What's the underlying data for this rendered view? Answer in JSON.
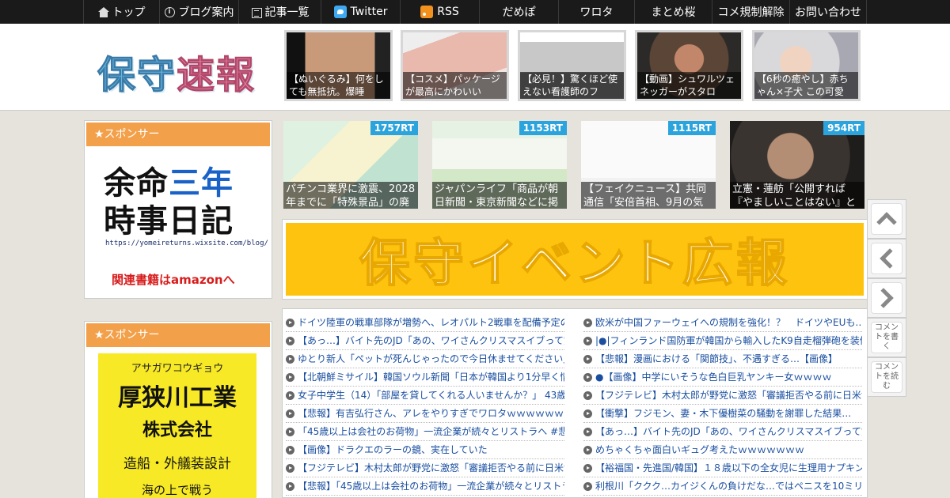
{
  "nav": [
    {
      "label": "トップ",
      "icon": "home-icon"
    },
    {
      "label": "ブログ案内",
      "icon": "info-icon"
    },
    {
      "label": "記事一覧",
      "icon": "list-icon"
    },
    {
      "label": "Twitter",
      "icon": "twitter-icon"
    },
    {
      "label": "RSS",
      "icon": "rss-icon"
    },
    {
      "label": "だめぽ",
      "icon": ""
    },
    {
      "label": "ワロタ",
      "icon": ""
    },
    {
      "label": "まとめ桜",
      "icon": ""
    },
    {
      "label": "コメ規制解除",
      "icon": ""
    },
    {
      "label": "お問い合わせ",
      "icon": ""
    }
  ],
  "header": {
    "logo_main": "保守",
    "logo_sub": "速報",
    "thumbs": [
      {
        "caption": "【ぬいぐるみ】何をしても無抵抗。爆睡"
      },
      {
        "caption": "【コスメ】パッケージが最高にかわいい"
      },
      {
        "caption": "【必見！】驚くほど使えない看護師のフ"
      },
      {
        "caption": "【動画】シュワルツェネッガーがスタロ"
      },
      {
        "caption": "【6秒の癒やし】赤ちゃん×子犬 この可愛"
      }
    ]
  },
  "sidebar": {
    "sponsor_label_1": "★スポンサー",
    "ad1_line1a": "余命",
    "ad1_line1b": "三年",
    "ad1_line2": "時事日記",
    "ad1_url": "https://yomeireturns.wixsite.com/blog/",
    "ad1_amazon": "関連書籍はamazonへ",
    "sponsor_label_2": "★スポンサー",
    "ad2_kana": "アサガワコウギョウ",
    "ad2_company": "厚狭川工業",
    "ad2_kk": "株式会社",
    "ad2_business": "造船・外艤装設計",
    "ad2_more": "海の上で戦う"
  },
  "featured": [
    {
      "rt": "1757RT",
      "caption": "パチンコ業界に激震、2028年までに「特殊景品」の廃"
    },
    {
      "rt": "1153RT",
      "caption": "ジャパンライフ「商品が朝日新聞・東京新聞などに掲"
    },
    {
      "rt": "1115RT",
      "caption": "【フェイクニュース】共同通信「安倍首相、9月の気候"
    },
    {
      "rt": "954RT",
      "caption": "立憲・蓮舫「公開すれば『やましいことはない』と"
    }
  ],
  "banner": {
    "text": "保守イベント広報"
  },
  "list_left": [
    "ドイツ陸軍の戦車部隊が増勢へ、レオパルト2戦車を配備予定の",
    "【あっ…】バイト先のJD「あの、ワイさんクリスマスイブって空いてますか？」",
    "ゆとり新人「ペットが死んじゃったので今日休ませてください」",
    "【北朝鮮ミサイル】韓国ソウル新聞「日本が韓国より1分早く情報を",
    "女子中学生（14）「部屋を貸してくれる人いませんか？」 43歳男性",
    "【悲報】有吉弘行さん、アレをやりすぎでワロタｗｗｗｗｗｗｗ",
    "「45歳以上は会社のお荷物」一流企業が続々とリストラへ #悲報",
    "【画像】ドラクエのラーの鏡、実在していた",
    "【フジテレビ】木村太郎が野党に激怒「審議拒否やる前に日米協議",
    "【悲報】「45歳以上は会社のお荷物」一流企業が続々とリストラへ"
  ],
  "list_right": [
    "欧米が中国ファーウェイへの規制を強化！？　ドイツやEUも…",
    "|●|フィンランド国防軍が韓国から輸入したK9自走榴弾砲を装備",
    "【悲報】漫画における「関節技」、不遇すぎる…【画像】",
    "●【画像】中学にいそうな色白巨乳ヤンキー女ｗｗｗｗ",
    "【フジテレビ】木村太郎が野党に激怒「審議拒否やる前に日米協議",
    "【衝撃】フジモン、妻・木下優樹菜の騒動を謝罪した結果…",
    "【あっ…】バイト先のJD「あの、ワイさんクリスマスイブって空いて",
    "めちゃくちゃ面白いギュグ考えたｗｗｗｗｗｗｗ",
    "【裕福国・先進国/韓国】１８歳以下の全女児に生理用ナプキンを",
    "利根川「ククク…カイジくんの負けだな…ではペニスを10ミリ"
  ],
  "float": {
    "comment_write": "コメントを書く",
    "comment_read": "コメントを読む"
  },
  "colors": {
    "accent_orange": "#f3a04a",
    "rt_blue": "#2ba3dc",
    "banner_yellow": "#fec30f",
    "link_blue": "#1a4fa0"
  }
}
